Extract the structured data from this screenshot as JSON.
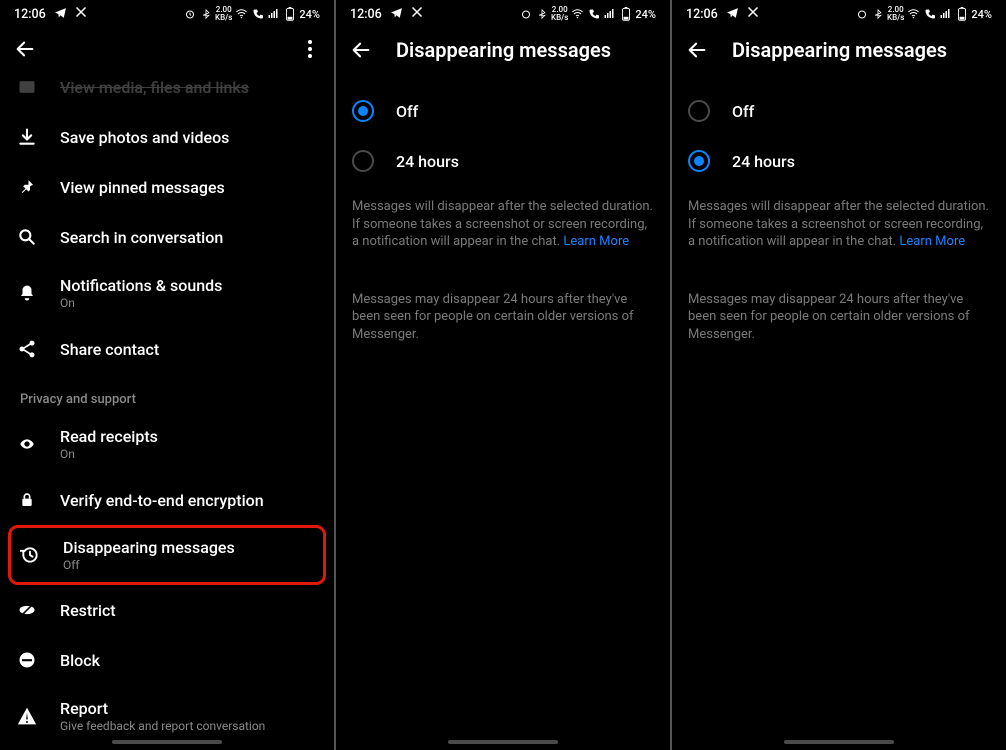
{
  "status": {
    "time": "12:06",
    "rate": "2.00",
    "rate_unit": "KB/s",
    "battery": "24%"
  },
  "screen1": {
    "items": {
      "media": "View media, files and links",
      "save": "Save photos and videos",
      "pinned": "View pinned messages",
      "search": "Search in conversation",
      "notif": "Notifications & sounds",
      "notif_sub": "On",
      "share": "Share contact",
      "section": "Privacy and support",
      "read": "Read receipts",
      "read_sub": "On",
      "verify": "Verify end-to-end encryption",
      "disappear": "Disappearing messages",
      "disappear_sub": "Off",
      "restrict": "Restrict",
      "block": "Block",
      "report": "Report",
      "report_sub": "Give feedback and report conversation"
    }
  },
  "screen2": {
    "title": "Disappearing messages",
    "opt_off": "Off",
    "opt_24h": "24 hours",
    "info1_a": "Messages will disappear after the selected duration. If someone takes a screenshot or screen recording, a notification will appear in the chat. ",
    "info1_link": "Learn More",
    "info2": "Messages may disappear 24 hours after they've been seen for people on certain older versions of Messenger."
  },
  "screen3": {
    "title": "Disappearing messages",
    "opt_off": "Off",
    "opt_24h": "24 hours",
    "info1_a": "Messages will disappear after the selected duration. If someone takes a screenshot or screen recording, a notification will appear in the chat. ",
    "info1_link": "Learn More",
    "info2": "Messages may disappear 24 hours after they've been seen for people on certain older versions of Messenger."
  }
}
